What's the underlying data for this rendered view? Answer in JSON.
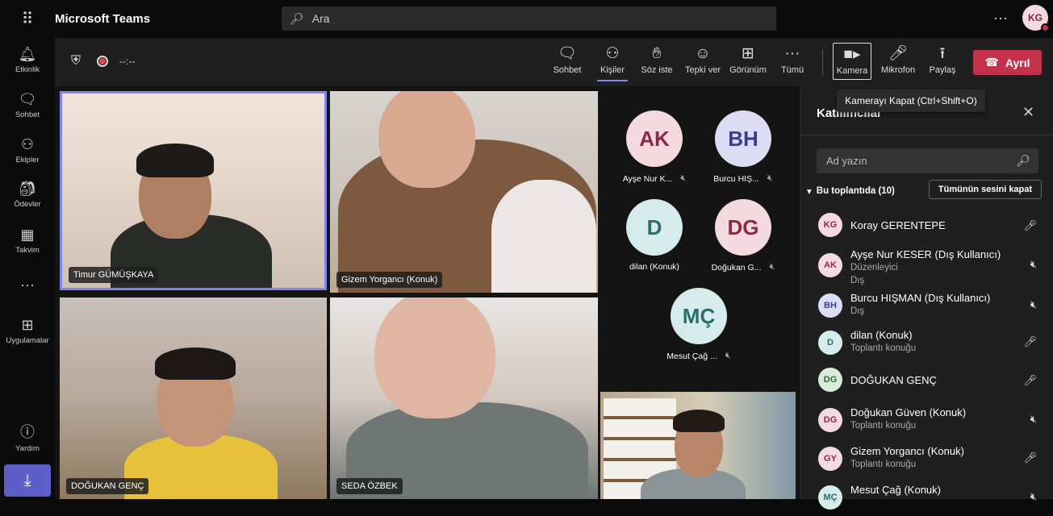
{
  "app": {
    "title": "Microsoft Teams",
    "search_placeholder": "Ara",
    "me_initials": "KG"
  },
  "rail": [
    {
      "label": "Etkinlik",
      "icon": "bell-icon"
    },
    {
      "label": "Sohbet",
      "icon": "chat-icon"
    },
    {
      "label": "Ekipler",
      "icon": "teams-icon"
    },
    {
      "label": "Ödevler",
      "icon": "assignments-icon"
    },
    {
      "label": "Takvim",
      "icon": "calendar-icon"
    },
    {
      "label": "Uygulamalar",
      "icon": "apps-icon"
    },
    {
      "label": "Yardım",
      "icon": "help-icon"
    }
  ],
  "meeting": {
    "timer": "--:--",
    "tools": {
      "chat": "Sohbet",
      "people": "Kişiler",
      "raise": "Söz iste",
      "react": "Tepki ver",
      "view": "Görünüm",
      "more": "Tümü",
      "camera": "Kamera",
      "mic": "Mikrofon",
      "share": "Paylaş"
    },
    "leave": "Ayrıl",
    "tooltip": "Kamerayı Kapat (Ctrl+Shift+O)"
  },
  "videos": [
    {
      "name": "Timur GÜMÜŞKAYA"
    },
    {
      "name": "Gizem Yorgancı (Konuk)"
    },
    {
      "name": "DOĞUKAN GENÇ"
    },
    {
      "name": "SEDA ÖZBEK"
    }
  ],
  "avatars": [
    {
      "initials": "AK",
      "name": "Ayşe Nur K...",
      "bg": "#f5d9e0",
      "fg": "#8a2a45"
    },
    {
      "initials": "BH",
      "name": "Burcu HIŞ...",
      "bg": "#dcdcf5",
      "fg": "#3b3d8a"
    },
    {
      "initials": "D",
      "name": "dilan (Konuk)",
      "bg": "#d6ecec",
      "fg": "#2a6b6b"
    },
    {
      "initials": "DG",
      "name": "Doğukan G...",
      "bg": "#f5d9e0",
      "fg": "#8a2a45"
    },
    {
      "initials": "MÇ",
      "name": "Mesut Çağ ...",
      "bg": "#d6ecec",
      "fg": "#2a6b6b"
    }
  ],
  "panel": {
    "title": "Katılımcılar",
    "search_placeholder": "Ad yazın",
    "section": "Bu toplantıda (10)",
    "mute_all": "Tümünün sesini kapat",
    "participants": [
      {
        "initials": "KG",
        "name": "Koray GERENTEPE",
        "sub1": "",
        "sub2": "",
        "bg": "#f5d9e0",
        "fg": "#8a2a45"
      },
      {
        "initials": "AK",
        "name": "Ayşe Nur KESER (Dış Kullanıcı)",
        "sub1": "Düzenleyici",
        "sub2": "Dış",
        "bg": "#f5d9e0",
        "fg": "#8a2a45"
      },
      {
        "initials": "BH",
        "name": "Burcu HIŞMAN (Dış Kullanıcı)",
        "sub1": "Dış",
        "sub2": "",
        "bg": "#dcdcf5",
        "fg": "#3b3d8a"
      },
      {
        "initials": "D",
        "name": "dilan (Konuk)",
        "sub1": "Toplantı konuğu",
        "sub2": "",
        "bg": "#d6ecec",
        "fg": "#2a6b6b"
      },
      {
        "initials": "DG",
        "name": "DOĞUKAN GENÇ",
        "sub1": "",
        "sub2": "",
        "bg": "#d9ecd9",
        "fg": "#2f6b2f"
      },
      {
        "initials": "DG",
        "name": "Doğukan Güven (Konuk)",
        "sub1": "Toplantı konuğu",
        "sub2": "",
        "bg": "#f5d9e0",
        "fg": "#8a2a45"
      },
      {
        "initials": "GY",
        "name": "Gizem Yorgancı (Konuk)",
        "sub1": "Toplantı konuğu",
        "sub2": "",
        "bg": "#f5d9e0",
        "fg": "#8a2a45"
      },
      {
        "initials": "MÇ",
        "name": "Mesut Çağ (Konuk)",
        "sub1": "",
        "sub2": "",
        "bg": "#d6ecec",
        "fg": "#2a6b6b"
      }
    ]
  },
  "colors": {
    "accent": "#7f85f5",
    "leave": "#c4314b",
    "download": "#5b5fc7"
  }
}
